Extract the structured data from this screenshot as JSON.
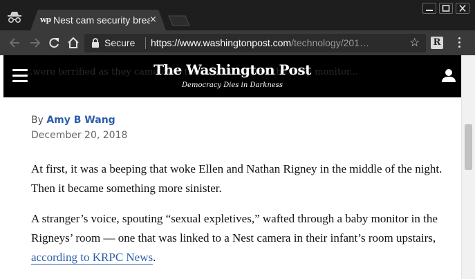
{
  "browser": {
    "tab": {
      "favicon": "wp",
      "title": "Nest cam security breach",
      "close_label": "×"
    },
    "window_controls": {
      "minimize": "minimize-icon",
      "maximize": "maximize-icon",
      "close": "close-icon"
    },
    "toolbar": {
      "security_label": "Secure",
      "url_host": "https://www.washingtonpost.com",
      "url_path": "/technology/201…",
      "extension_label": "R"
    }
  },
  "page": {
    "masthead": {
      "logo": "The Washington Post",
      "tagline": "Democracy Dies in Darkness",
      "ghost_text": "...were terrified as they came over the... house to find the baby monitor..."
    },
    "article": {
      "by_prefix": "By",
      "author": "Amy B Wang",
      "date": "December 20, 2018",
      "paragraph1": "At first, it was a beeping that woke Ellen and Nathan Rigney in the middle of the night. Then it became something more sinister.",
      "paragraph2_text": "A stranger’s voice, spouting “sexual expletives,” wafted through a baby monitor in the Rigneys’ room — one that was linked to a Nest camera in their infant’s room upstairs,",
      "paragraph2_link": "according to KRPC News",
      "paragraph2_end": "."
    }
  },
  "colors": {
    "link": "#2a5ea8",
    "masthead_bg": "#000000",
    "chrome_dark": "#1e1e1e"
  }
}
